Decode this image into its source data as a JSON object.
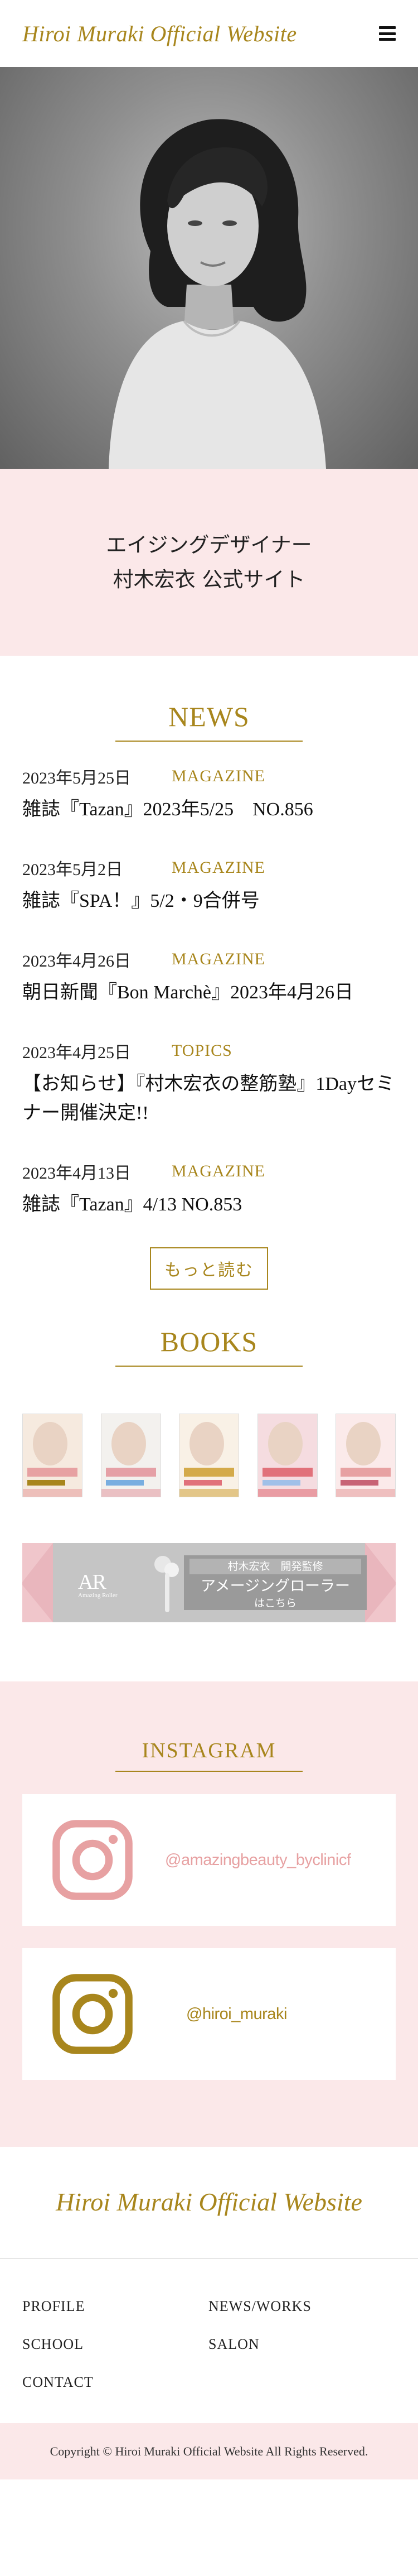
{
  "header": {
    "site_title": "Hiroi Muraki Official Website",
    "menu_icon": "hamburger-menu-icon"
  },
  "hero": {
    "image_alt": "portrait photo"
  },
  "intro": {
    "line1": "エイジングデザイナー",
    "line2": "村木宏衣 公式サイト"
  },
  "news": {
    "heading": "NEWS",
    "items": [
      {
        "date": "2023年5月25日",
        "category": "MAGAZINE",
        "title": "雑誌『Tazan』2023年5/25　NO.856"
      },
      {
        "date": "2023年5月2日",
        "category": "MAGAZINE",
        "title": "雑誌『SPA！』5/2・9合併号"
      },
      {
        "date": "2023年4月26日",
        "category": "MAGAZINE",
        "title": "朝日新聞『Bon Marchè』2023年4月26日"
      },
      {
        "date": "2023年4月25日",
        "category": "TOPICS",
        "title": "【お知らせ】『村木宏衣の整筋塾』1Dayセミナー開催決定!!"
      },
      {
        "date": "2023年4月13日",
        "category": "MAGAZINE",
        "title": "雑誌『Tazan』4/13 NO.853"
      }
    ],
    "more_label": "もっと読む"
  },
  "books": {
    "heading": "BOOKS",
    "covers": [
      {
        "colors": [
          "#f6eadf",
          "#e7a1a2",
          "#a8861d"
        ]
      },
      {
        "colors": [
          "#f3f1ee",
          "#e5a0a6",
          "#79aee0"
        ]
      },
      {
        "colors": [
          "#f9f1e6",
          "#d4aa4a",
          "#e1717a"
        ]
      },
      {
        "colors": [
          "#f5dce0",
          "#e1717a",
          "#a0c0e8"
        ]
      },
      {
        "colors": [
          "#fbeaea",
          "#e7a1a2",
          "#c86476"
        ]
      }
    ]
  },
  "banner": {
    "logo_text": "AR",
    "logo_sub": "Amazing Roller",
    "supervisor": "村木宏衣　開発監修",
    "product": "アメージングローラー",
    "link": "はこちら",
    "colors": {
      "side": "#e9b6bd",
      "center": "#c5c5c5",
      "box": "#9a9a9a"
    }
  },
  "instagram": {
    "heading": "INSTAGRAM",
    "accounts": [
      {
        "handle": "@amazingbeauty_byclinicf",
        "color": "#e7a1a2"
      },
      {
        "handle": "@hiroi_muraki",
        "color": "#a8861d"
      }
    ]
  },
  "footer": {
    "title": "Hiroi Muraki Official Website",
    "nav": [
      "PROFILE",
      "NEWS/WORKS",
      "SCHOOL",
      "SALON",
      "CONTACT"
    ],
    "copyright": "Copyright © Hiroi Muraki Official Website All Rights Reserved."
  },
  "colors": {
    "accent_gold": "#a8861d",
    "pink_bg": "#fbe8e9",
    "instagram_pink": "#e7a1a2"
  }
}
